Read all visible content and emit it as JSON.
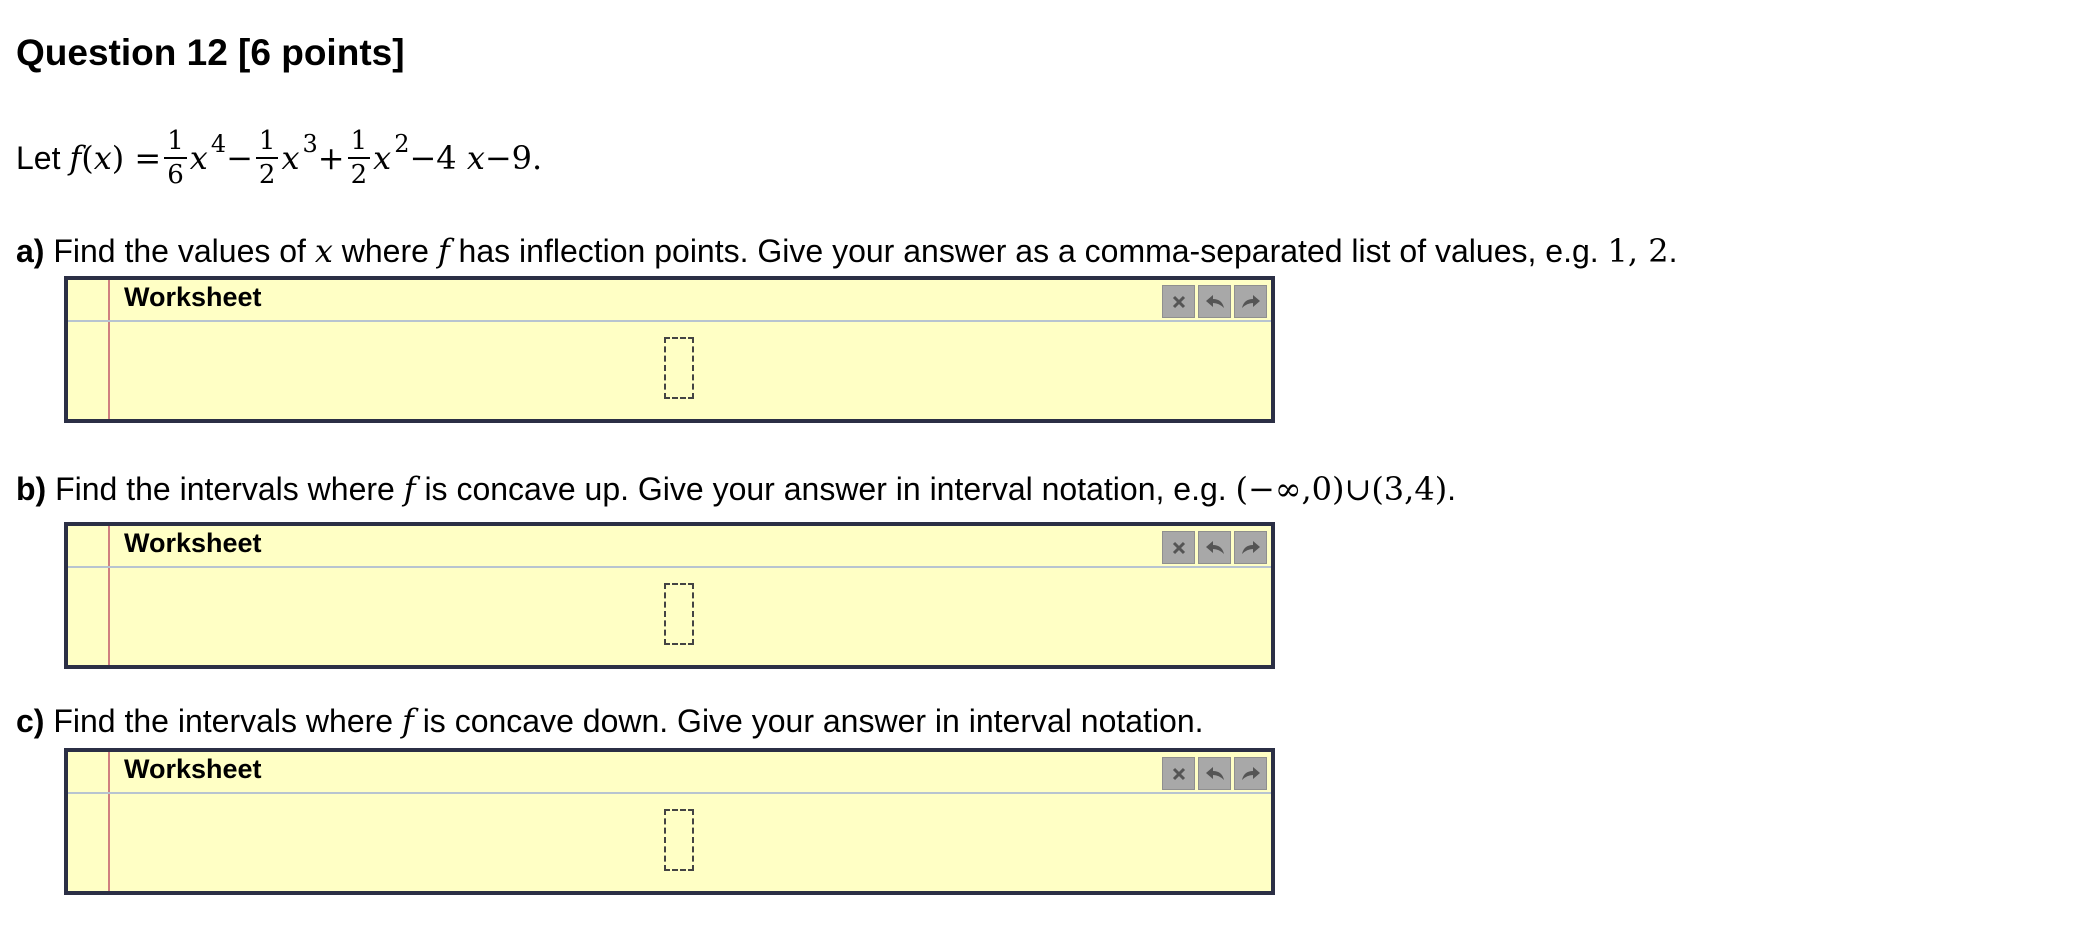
{
  "question": {
    "title": "Question 12 [6 points]"
  },
  "premise": {
    "let_text": "Let",
    "function_name": "f",
    "variable": "x",
    "equals": "=",
    "coef1_num": "1",
    "coef1_den": "6",
    "exp1": "4",
    "op1": "−",
    "coef2_num": "1",
    "coef2_den": "2",
    "exp2": "3",
    "op2": "+",
    "coef3_num": "1",
    "coef3_den": "2",
    "exp3": "2",
    "tail": "−4",
    "tail2": "−9",
    "period": "."
  },
  "parts": [
    {
      "label": "a)",
      "text_before": "Find the values of",
      "var": "x",
      "text_mid": "where",
      "func": "f",
      "text_after": "has inflection points. Give your answer as a comma-separated list of values, e.g.",
      "example": "1, 2",
      "end": "."
    },
    {
      "label": "b)",
      "text_before": "Find the intervals where",
      "func": "f",
      "text_after": "is concave up. Give your answer in interval notation, e.g.",
      "example": "(−∞,0)∪(3,4)",
      "end": "."
    },
    {
      "label": "c)",
      "text_before": "Find the intervals where",
      "func": "f",
      "text_after": "is concave down. Give your answer in interval notation."
    }
  ],
  "worksheet": {
    "title": "Worksheet",
    "tools": [
      {
        "icon": "close-icon",
        "glyph": "✕"
      },
      {
        "icon": "undo-icon",
        "glyph": "↶"
      },
      {
        "icon": "redo-icon",
        "glyph": "↷"
      }
    ],
    "colors": {
      "background": "#ffffc5",
      "border": "#2b2f45",
      "margin_line": "#d08080",
      "tool_button": "#a8a8a8"
    }
  }
}
